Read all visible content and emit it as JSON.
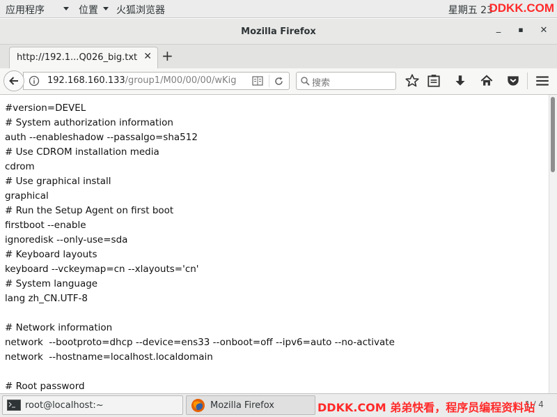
{
  "topbar": {
    "applications": "应用程序",
    "places": "位置",
    "firefox_app": "火狐浏览器",
    "clock": "星期五 23",
    "watermark": "DDKK.COM"
  },
  "window": {
    "title": "Mozilla Firefox",
    "minimize": "_",
    "maximize": "▪",
    "close": "✕"
  },
  "tabs": [
    {
      "label": "http://192.1...Q026_big.txt",
      "close": "✕"
    }
  ],
  "newtab": "+",
  "urlbar": {
    "host": "192.168.160.133",
    "path": "/group1/M00/00/00/wKig"
  },
  "search": {
    "placeholder": "搜索"
  },
  "document": {
    "lines": [
      "#version=DEVEL",
      "# System authorization information",
      "auth --enableshadow --passalgo=sha512",
      "# Use CDROM installation media",
      "cdrom",
      "# Use graphical install",
      "graphical",
      "# Run the Setup Agent on first boot",
      "firstboot --enable",
      "ignoredisk --only-use=sda",
      "# Keyboard layouts",
      "keyboard --vckeymap=cn --xlayouts='cn'",
      "# System language",
      "lang zh_CN.UTF-8",
      "",
      "# Network information",
      "network  --bootproto=dhcp --device=ens33 --onboot=off --ipv6=auto --no-activate",
      "network  --hostname=localhost.localdomain",
      "",
      "# Root password"
    ]
  },
  "taskbar": {
    "terminal": "root@localhost:~",
    "firefox": "Mozilla Firefox",
    "watermark": "DDKK.COM 弟弟快看，程序员编程资料站",
    "pager": "1 / 4"
  },
  "colors": {
    "watermark": "#ff2a2a",
    "firefox_orange": "#e66000"
  }
}
